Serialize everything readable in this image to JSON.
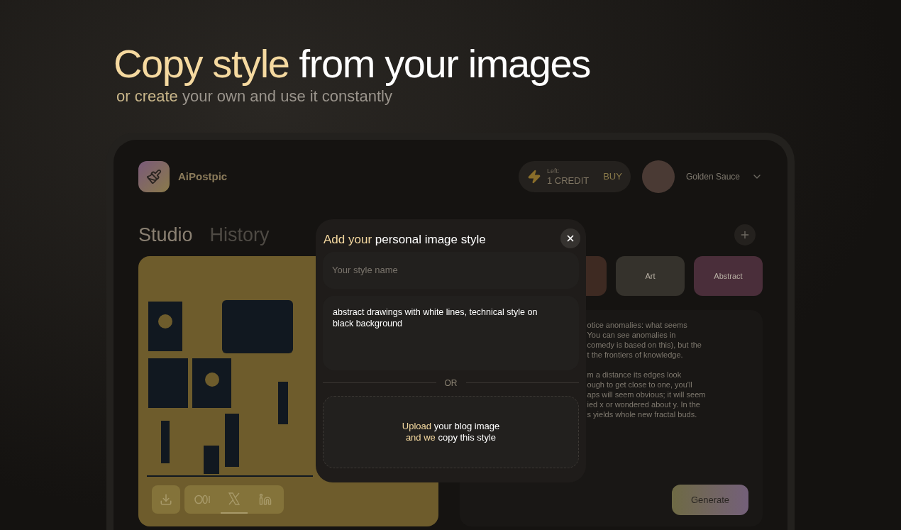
{
  "hero": {
    "title_highlight": "Copy style",
    "title_rest": "from your images",
    "subtitle_highlight": "or create",
    "subtitle_rest": "your own and use it constantly"
  },
  "header": {
    "app_name": "AiPostpic",
    "credits_label": "Left:",
    "credits_value": "1 CREDIT",
    "buy": "BUY",
    "user_name": "Golden Sauce"
  },
  "tabs": [
    {
      "label": "Studio",
      "selected": true
    },
    {
      "label": "History",
      "selected": false
    }
  ],
  "share_buttons": [
    {
      "kind": "medium",
      "selected": false
    },
    {
      "kind": "x",
      "selected": true
    },
    {
      "kind": "linkedin",
      "selected": false
    }
  ],
  "styles": [
    {
      "color": "#3e2a22"
    },
    {
      "label": "Art",
      "color": "#35322c"
    },
    {
      "label": "Abstract",
      "color": "#4a2e3a"
    }
  ],
  "prompt_paragraphs": [
    [
      "otice anomalies: what seems",
      "You can see anomalies in",
      "comedy is based on this), but the",
      "t the frontiers of knowledge."
    ],
    [
      "m a distance its edges look",
      "ough to get close to one, you'll",
      "aps will seem obvious; it will seem",
      "ied x or wondered about y. In the",
      "s yields whole new fractal buds."
    ]
  ],
  "generate": "Generate",
  "modal": {
    "title_highlight": "Add your",
    "title_rest": "personal image style",
    "name_placeholder": "Your style name",
    "description": "abstract drawings with white lines, technical style on black background",
    "divider": "OR",
    "upload_line1_highlight": "Upload",
    "upload_line1_rest": "your blog image",
    "upload_line2_highlight": "and we",
    "upload_line2_rest": "copy this style"
  }
}
